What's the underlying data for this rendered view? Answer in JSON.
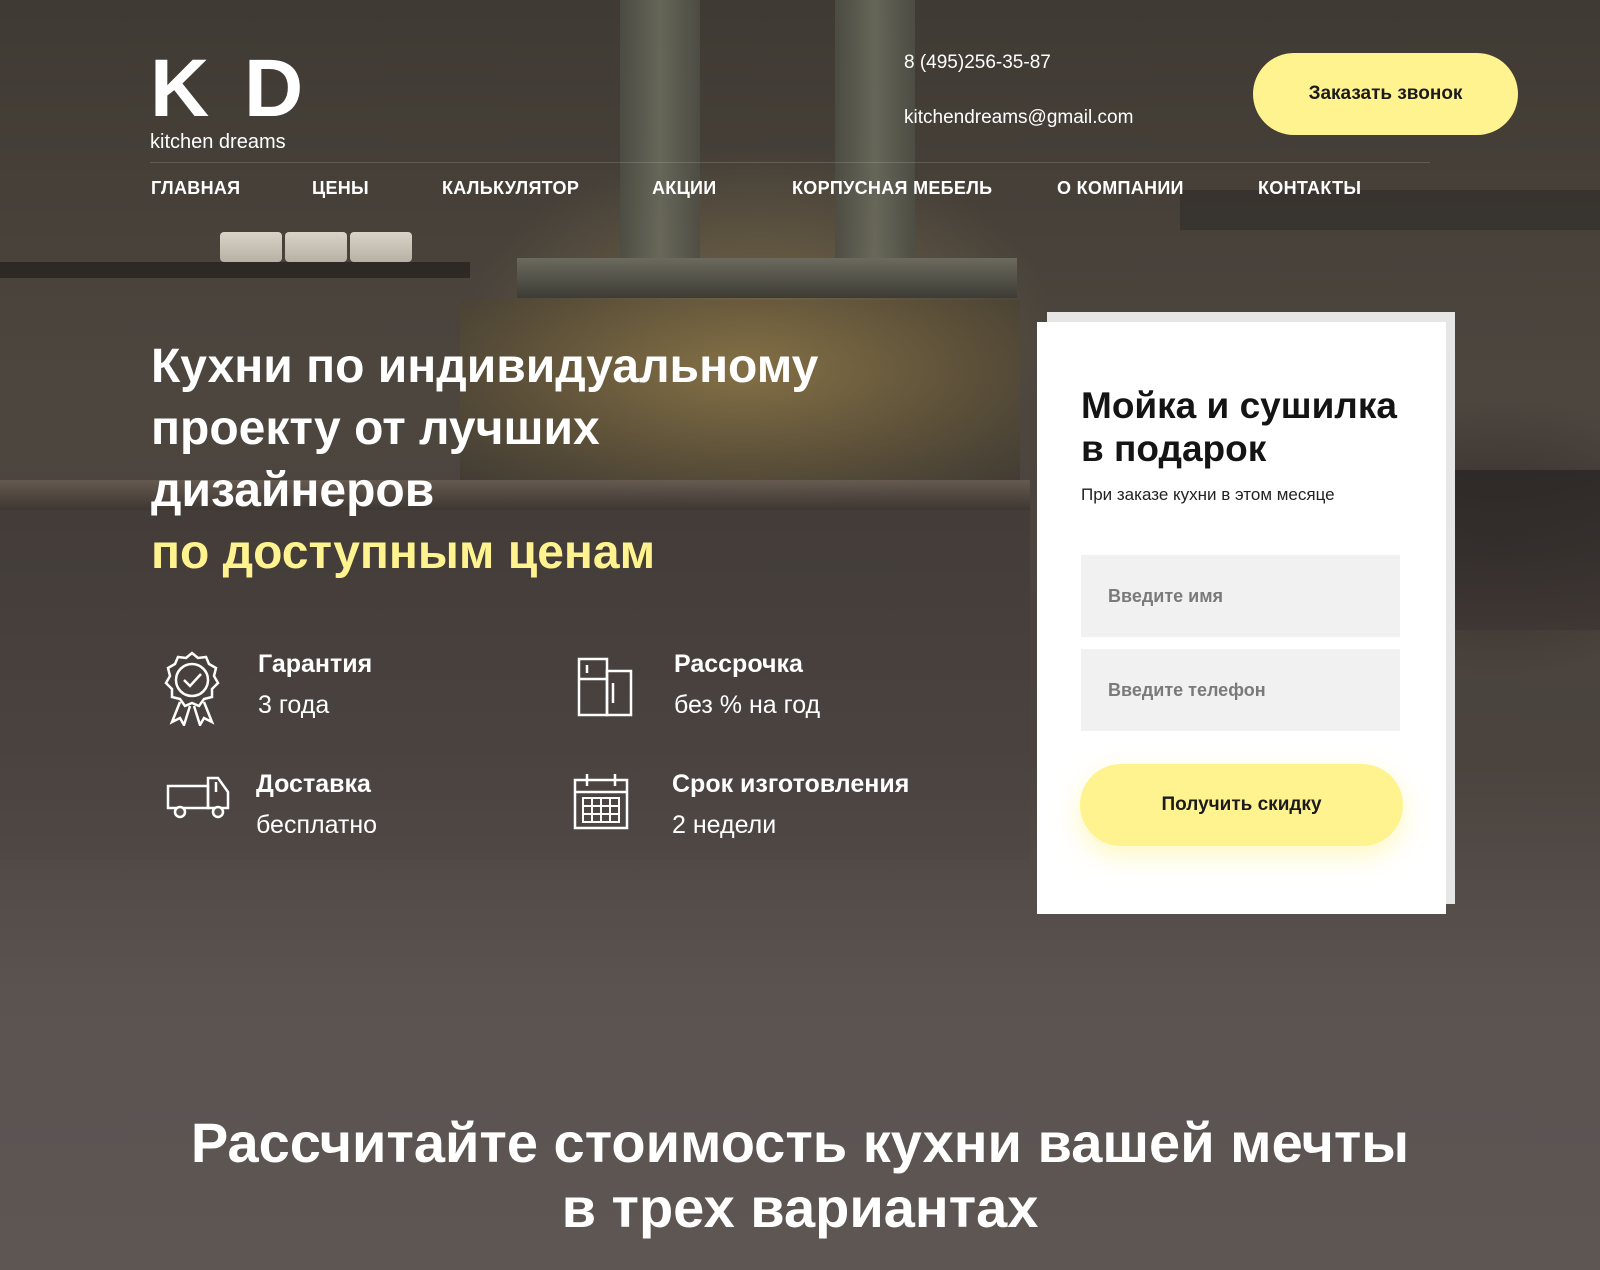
{
  "brand": {
    "logo": "K D",
    "tagline": "kitchen dreams"
  },
  "contacts": {
    "phone": "8 (495)256-35-87",
    "email": "kitchendreams@gmail.com"
  },
  "header": {
    "call_button": "Заказать звонок"
  },
  "nav": {
    "items": [
      {
        "label": "ГЛАВНАЯ"
      },
      {
        "label": "ЦЕНЫ"
      },
      {
        "label": "КАЛЬКУЛЯТОР"
      },
      {
        "label": "АКЦИИ"
      },
      {
        "label": "КОРПУСНАЯ МЕБЕЛЬ"
      },
      {
        "label": "О КОМПАНИИ"
      },
      {
        "label": "КОНТАКТЫ"
      }
    ]
  },
  "hero": {
    "line1": "Кухни по индивидуальному",
    "line2": "проекту от лучших",
    "line3": "дизайнеров",
    "accent": "по доступным ценам"
  },
  "features": [
    {
      "icon": "award-icon",
      "title": "Гарантия",
      "subtitle": "3 года"
    },
    {
      "icon": "fridge-icon",
      "title": "Рассрочка",
      "subtitle": "без % на год"
    },
    {
      "icon": "truck-icon",
      "title": "Доставка",
      "subtitle": "бесплатно"
    },
    {
      "icon": "calendar-icon",
      "title": "Срок изготовления",
      "subtitle": "2 недели"
    }
  ],
  "promo": {
    "title": "Мойка и сушилка в подарок",
    "subtitle": "При заказе кухни в этом месяце",
    "name_placeholder": "Введите имя",
    "phone_placeholder": "Введите телефон",
    "button": "Получить скидку"
  },
  "calculator": {
    "title_line1": "Рассчитайте стоимость кухни вашей мечты",
    "title_line2": "в трех вариантах"
  },
  "colors": {
    "accent": "#fff38f",
    "background": "#5d5552",
    "card": "#ffffff"
  }
}
